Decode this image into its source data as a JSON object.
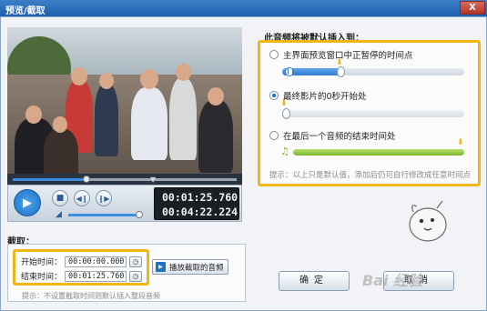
{
  "window": {
    "title": "预览/截取",
    "close_label": "X"
  },
  "player": {
    "current_time": "00:01:25.760",
    "total_time": "00:04:22.224",
    "seek_progress": 0.33,
    "volume": 1.0
  },
  "insert": {
    "heading": "此音频将被默认插入到：",
    "options": [
      {
        "label": "主界面预览窗口中正暂停的时间点",
        "checked": false
      },
      {
        "label": "最终影片的0秒开始处",
        "checked": true
      },
      {
        "label": "在最后一个音频的结束时间处",
        "checked": false
      }
    ],
    "hint": "提示：以上只是默认值，添加后仍可自行修改成任意时间点"
  },
  "cut": {
    "heading": "截取：",
    "start_label": "开始时间：",
    "start_value": "00:00:00.000",
    "end_label": "结束时间：",
    "end_value": "00:01:25.760",
    "play_label": "播放截取的音频",
    "hint": "提示：不设置截取时间则默认插入整段音频"
  },
  "buttons": {
    "ok": "确定",
    "cancel": "取消"
  },
  "watermark": "Bai 经验",
  "colors": {
    "highlight": "#f2b515",
    "accent": "#1f6fc2",
    "green": "#7ab82a"
  }
}
